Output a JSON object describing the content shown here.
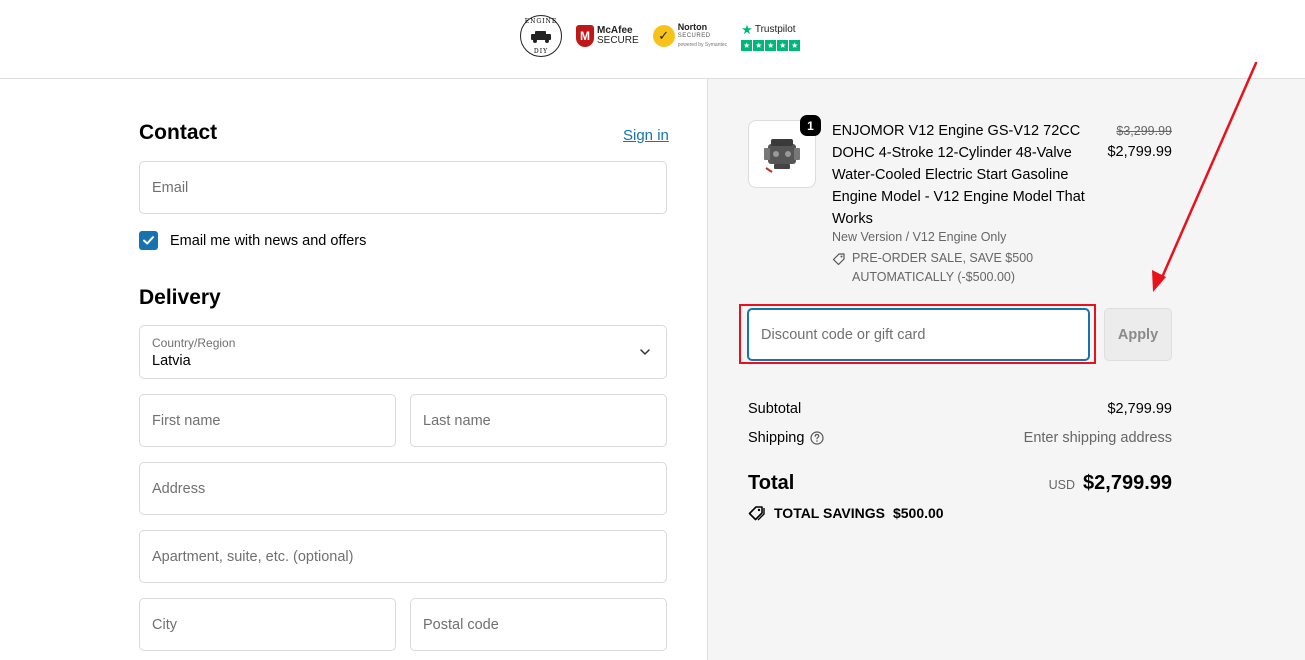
{
  "header": {
    "engine_badge_top": "ENGINE",
    "engine_badge_bottom": "DIY",
    "mcafee_name": "McAfee",
    "mcafee_sub": "SECURE",
    "norton_name": "Norton",
    "norton_sub": "SECURED",
    "norton_powered": "powered by Symantec",
    "trustpilot_name": "Trustpilot"
  },
  "contact": {
    "title": "Contact",
    "sign_in": "Sign in",
    "email_placeholder": "Email",
    "newsletter_label": "Email me with news and offers"
  },
  "delivery": {
    "title": "Delivery",
    "country_label": "Country/Region",
    "country_value": "Latvia",
    "first_name_placeholder": "First name",
    "last_name_placeholder": "Last name",
    "address_placeholder": "Address",
    "apartment_placeholder": "Apartment, suite, etc. (optional)",
    "city_placeholder": "City",
    "postal_placeholder": "Postal code"
  },
  "summary": {
    "quantity": "1",
    "product_title": "ENJOMOR V12 Engine GS-V12 72CC DOHC 4-Stroke 12-Cylinder 48-Valve Water-Cooled Electric Start Gasoline Engine Model - V12 Engine Model That Works",
    "variant": "New Version / V12 Engine Only",
    "discount_line1": "PRE-ORDER SALE, SAVE $500",
    "discount_line2": "AUTOMATICALLY (-$500.00)",
    "price_old": "$3,299.99",
    "price_new": "$2,799.99",
    "discount_placeholder": "Discount code or gift card",
    "apply_label": "Apply",
    "subtotal_label": "Subtotal",
    "subtotal_value": "$2,799.99",
    "shipping_label": "Shipping",
    "shipping_value": "Enter shipping address",
    "total_label": "Total",
    "currency": "USD",
    "total_value": "$2,799.99",
    "savings_label": "TOTAL SAVINGS",
    "savings_value": "$500.00"
  },
  "colors": {
    "accent": "#1773b0",
    "highlight": "#e8121d",
    "trustpilot": "#00b67a"
  }
}
